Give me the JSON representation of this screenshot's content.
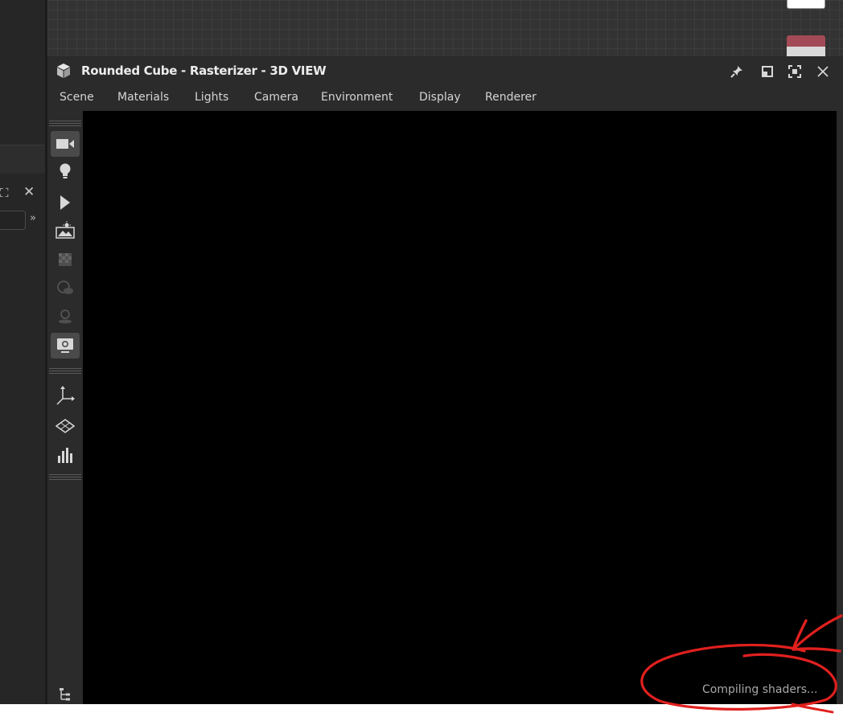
{
  "window": {
    "title": "Rounded Cube - Rasterizer - 3D VIEW",
    "title_icon": "cube-icon",
    "buttons": [
      {
        "name": "pin-icon",
        "glyph": "📌"
      },
      {
        "name": "float-window-icon",
        "glyph": "◧"
      },
      {
        "name": "maximize-icon",
        "glyph": "⛶"
      },
      {
        "name": "close-icon",
        "glyph": "✕"
      }
    ]
  },
  "menu": {
    "items": [
      "Scene",
      "Materials",
      "Lights",
      "Camera",
      "Environment",
      "Display",
      "Renderer"
    ]
  },
  "toolbar": {
    "tools": [
      {
        "name": "camera-icon",
        "glyph": "▬◀",
        "active": true
      },
      {
        "name": "light-bulb-icon",
        "glyph": "💡",
        "active": false
      },
      {
        "name": "select-arrow-icon",
        "glyph": "➤",
        "active": false
      },
      {
        "name": "environment-image-icon",
        "glyph": "▦",
        "active": false
      },
      {
        "name": "texture-icon",
        "glyph": "▩",
        "active": false,
        "disabled": true
      },
      {
        "name": "sphere-icon",
        "glyph": "◐",
        "active": false,
        "disabled": true
      },
      {
        "name": "shadow-icon",
        "glyph": "⚇",
        "active": false,
        "disabled": true
      },
      {
        "name": "display-settings-icon",
        "glyph": "⚙",
        "active": true
      },
      {
        "name": "axis-gizmo-icon",
        "glyph": "⊥",
        "active": false
      },
      {
        "name": "grid-plane-icon",
        "glyph": "◇",
        "active": false
      },
      {
        "name": "statistics-icon",
        "glyph": "▁▃▅",
        "active": false
      },
      {
        "name": "scene-tree-icon",
        "glyph": "⊞",
        "active": false
      }
    ]
  },
  "status": {
    "text": "Compiling shaders..."
  },
  "left_panel": {
    "expand_chevron": "»",
    "maximize_glyph": "⛶",
    "close_glyph": "✕"
  },
  "colors": {
    "panel_bg": "#2b2b2b",
    "viewport_bg": "#000000",
    "annotation_red": "#e0201e",
    "node_red": "#a34a56"
  }
}
